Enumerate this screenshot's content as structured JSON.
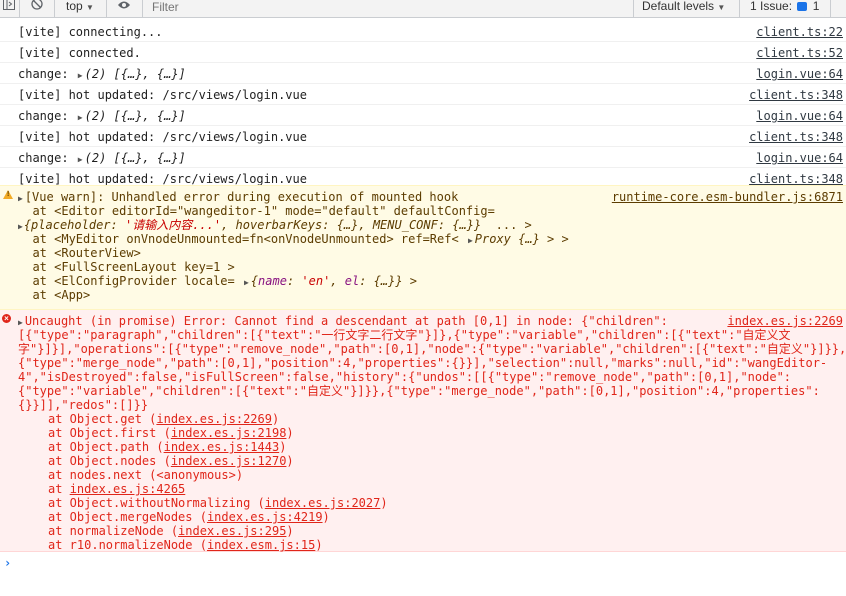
{
  "toolbar": {
    "context": "top",
    "filter_placeholder": "Filter",
    "levels": "Default levels",
    "issues_label": "1 Issue:",
    "issues_count": "1"
  },
  "logs": [
    {
      "msg": "[vite] connecting...",
      "src": "client.ts:22"
    },
    {
      "msg": "[vite] connected.",
      "src": "client.ts:52"
    },
    {
      "prefix": "change: ",
      "obj": "(2) [{…}, {…}]",
      "src": "login.vue:64"
    },
    {
      "msg": "[vite] hot updated: /src/views/login.vue",
      "src": "client.ts:348"
    },
    {
      "prefix": "change: ",
      "obj": "(2) [{…}, {…}]",
      "src": "login.vue:64"
    },
    {
      "msg": "[vite] hot updated: /src/views/login.vue",
      "src": "client.ts:348"
    },
    {
      "prefix": "change: ",
      "obj": "(2) [{…}, {…}]",
      "src": "login.vue:64"
    },
    {
      "msg": "[vite] hot updated: /src/views/login.vue",
      "src": "client.ts:348"
    }
  ],
  "warning": {
    "title": "[Vue warn]: Unhandled error during execution of mounted hook",
    "src": "runtime-core.esm-bundler.js:6871",
    "l2": "  at <Editor editorId=\"wangeditor-1\" mode=\"default\" defaultConfig=",
    "l3_a": "{placeholder: ",
    "l3_str": "'请输入内容...'",
    "l3_b": ", hoverbarKeys: {…}, MENU_CONF: {…}}",
    "l3_c": "  ... >",
    "l4_a": "  at <MyEditor onVnodeUnmounted=fn<onVnodeUnmounted> ref=Ref< ",
    "l4_b": "Proxy {…}",
    "l4_c": " > >",
    "l5": "  at <RouterView>",
    "l6": "  at <FullScreenLayout key=1 >",
    "l7_a": "  at <ElConfigProvider locale= ",
    "l7_b1": "{",
    "l7_key1": "name",
    "l7_b2": ": ",
    "l7_str": "'en'",
    "l7_b3": ", ",
    "l7_key2": "el",
    "l7_b4": ": {…}}",
    "l7_c": " >",
    "l8": "  at <App>"
  },
  "error": {
    "l1": "Uncaught (in promise) Error: Cannot find a descendant at path [0,1] in node: {\"children\":",
    "src": "index.es.js:2269",
    "l2": "[{\"type\":\"paragraph\",\"children\":[{\"text\":\"一行文字二行文字\"}]},{\"type\":\"variable\",\"children\":[{\"text\":\"自定义文",
    "l3": "字\"}]}],\"operations\":[{\"type\":\"remove_node\",\"path\":[0,1],\"node\":{\"type\":\"variable\",\"children\":[{\"text\":\"自定义\"}]}},",
    "l4": "{\"type\":\"merge_node\",\"path\":[0,1],\"position\":4,\"properties\":{}}],\"selection\":null,\"marks\":null,\"id\":\"wangEditor-",
    "l5": "4\",\"isDestroyed\":false,\"isFullScreen\":false,\"history\":{\"undos\":[[{\"type\":\"remove_node\",\"path\":[0,1],\"node\":",
    "l6": "{\"type\":\"variable\",\"children\":[{\"text\":\"自定义\"}]}},{\"type\":\"merge_node\",\"path\":[0,1],\"position\":4,\"properties\":",
    "l7": "{}}]],\"redos\":[]}}",
    "stack": [
      {
        "pre": "at Object.get (",
        "link": "index.es.js:2269",
        "post": ")"
      },
      {
        "pre": "at Object.first (",
        "link": "index.es.js:2198",
        "post": ")"
      },
      {
        "pre": "at Object.path (",
        "link": "index.es.js:1443",
        "post": ")"
      },
      {
        "pre": "at Object.nodes (",
        "link": "index.es.js:1270",
        "post": ")"
      },
      {
        "pre": "at nodes.next (<anonymous>)",
        "link": "",
        "post": ""
      },
      {
        "pre": "at ",
        "link": "index.es.js:4265",
        "post": ""
      },
      {
        "pre": "at Object.withoutNormalizing (",
        "link": "index.es.js:2027",
        "post": ")"
      },
      {
        "pre": "at Object.mergeNodes (",
        "link": "index.es.js:4219",
        "post": ")"
      },
      {
        "pre": "at normalizeNode (",
        "link": "index.es.js:295",
        "post": ")"
      },
      {
        "pre": "at r10.normalizeNode (",
        "link": "index.esm.js:15",
        "post": ")"
      }
    ]
  },
  "prompt_symbol": "›"
}
